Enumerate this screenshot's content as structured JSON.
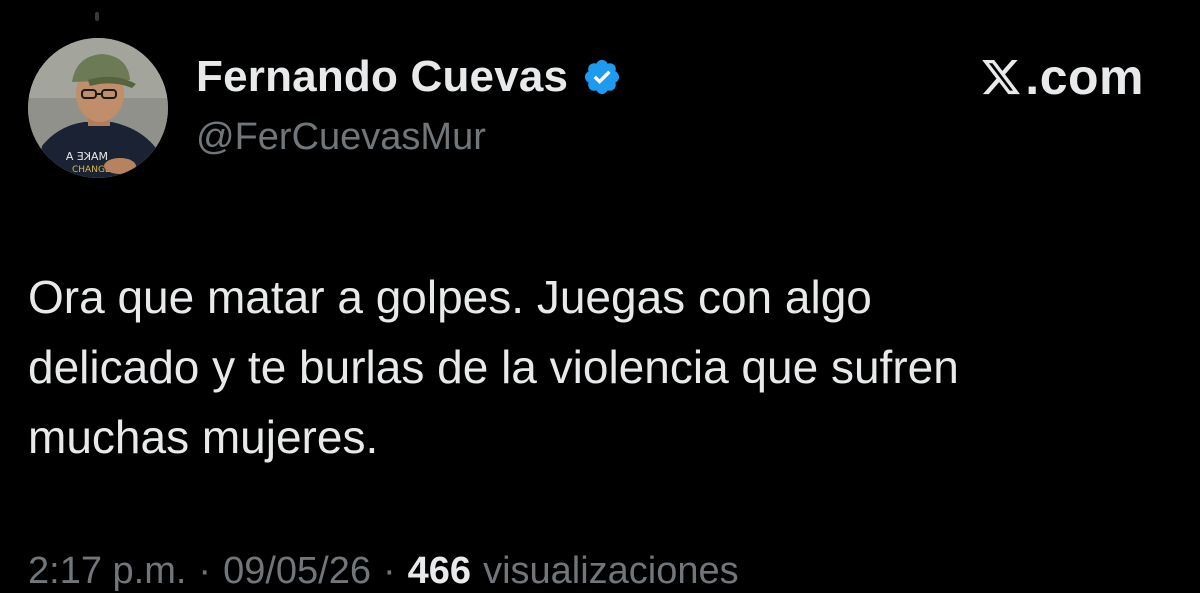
{
  "author": {
    "display_name": "Fernando Cuevas",
    "handle": "@FerCuevasMur",
    "verified_icon": "verified-badge-icon",
    "avatar_shirt_text": "MAKE A CHANGE"
  },
  "brand": {
    "logo_icon": "x-logo-icon",
    "text": ".com"
  },
  "tweet": {
    "text": "Ora que matar a golpes. Juegas con algo\ndelicado y te burlas de la violencia que sufren\nmuchas mujeres."
  },
  "meta": {
    "time": "2:17 p.m.",
    "separator": "·",
    "date": "09/05/26",
    "views_count": "466",
    "views_label": "visualizaciones"
  },
  "colors": {
    "background": "#000000",
    "primary_text": "#e7e9ea",
    "secondary_text": "#71767b",
    "verified_blue": "#1d9bf0"
  }
}
